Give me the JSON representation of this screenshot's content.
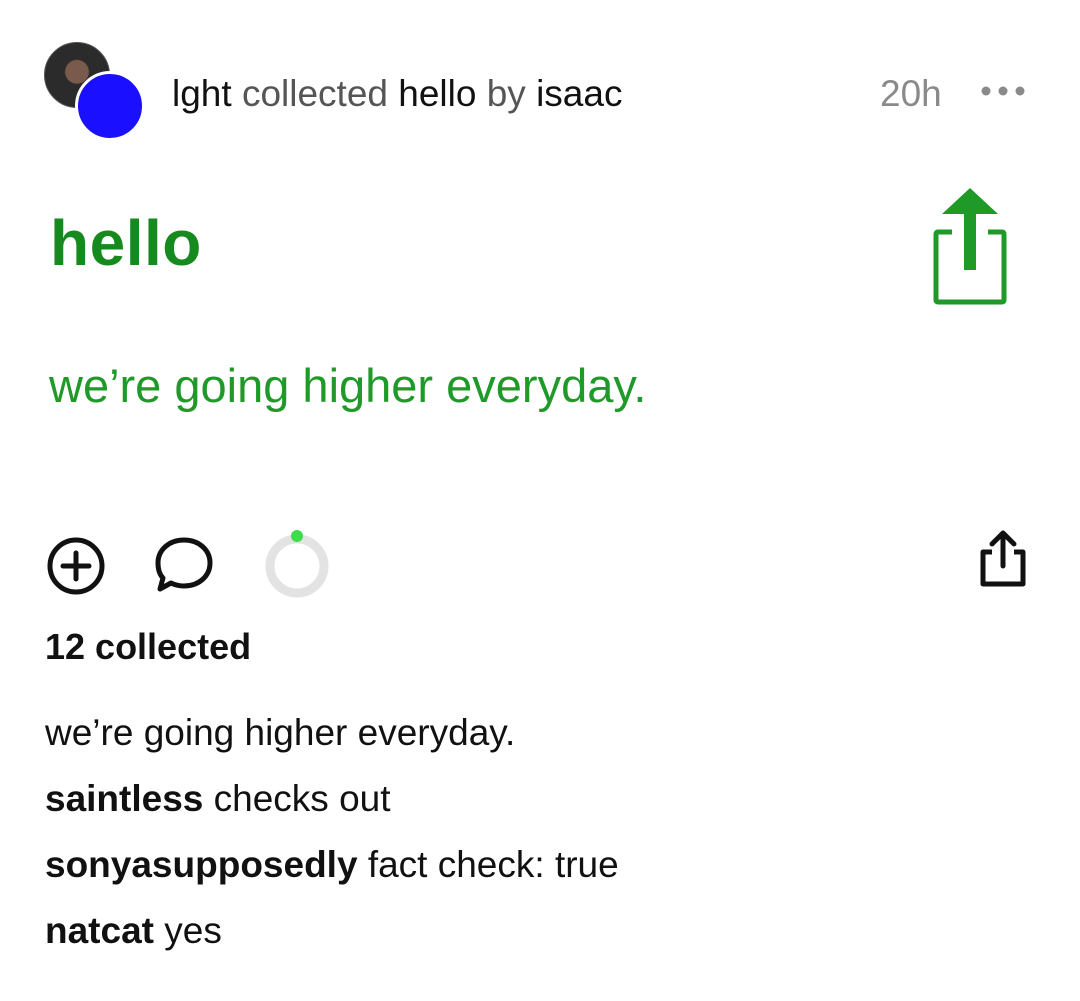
{
  "header": {
    "actor": "lght",
    "verb": "collected",
    "item": "hello",
    "by_word": "by",
    "author": "isaac",
    "time": "20h",
    "more_icon": "ellipsis-icon"
  },
  "post": {
    "title": "hello",
    "body": "we’re going higher everyday.",
    "accent_color": "#168a1f",
    "share_icon": "share-arrow-icon"
  },
  "actions": {
    "collect_icon": "plus-circle-icon",
    "comment_icon": "speech-bubble-icon",
    "progress_icon": "progress-ring-icon",
    "share_icon": "share-icon",
    "progress_fraction": 0.0
  },
  "stats": {
    "collected_label": "12 collected"
  },
  "caption": "we’re going higher everyday.",
  "comments": [
    {
      "user": "saintless",
      "text": "checks out"
    },
    {
      "user": "sonyasupposedly",
      "text": "fact check: true"
    },
    {
      "user": "natcat",
      "text": "yes"
    }
  ]
}
